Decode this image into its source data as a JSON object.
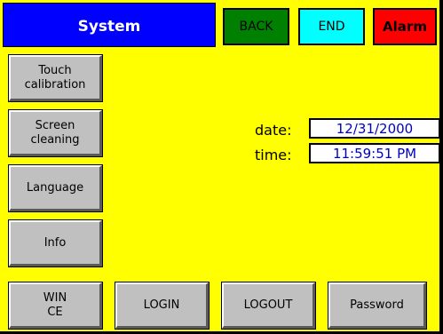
{
  "header": {
    "title": "System",
    "back_label": "BACK",
    "end_label": "END",
    "alarm_label": "Alarm"
  },
  "side_buttons": {
    "touch_calibration": "Touch\ncalibration",
    "screen_cleaning": "Screen\ncleaning",
    "language": "Language",
    "info": "Info"
  },
  "datetime": {
    "date_label": "date:",
    "date_value": "12/31/2000",
    "time_label": "time:",
    "time_value": "11:59:51 PM"
  },
  "bottom_buttons": {
    "win_ce": "WIN\nCE",
    "login": "LOGIN",
    "logout": "LOGOUT",
    "password": "Password"
  },
  "colors": {
    "background": "#ffff00",
    "title_bar": "#0000ff",
    "back": "#008000",
    "end": "#00ffff",
    "alarm": "#ff0000",
    "button": "#c0c0c0"
  }
}
